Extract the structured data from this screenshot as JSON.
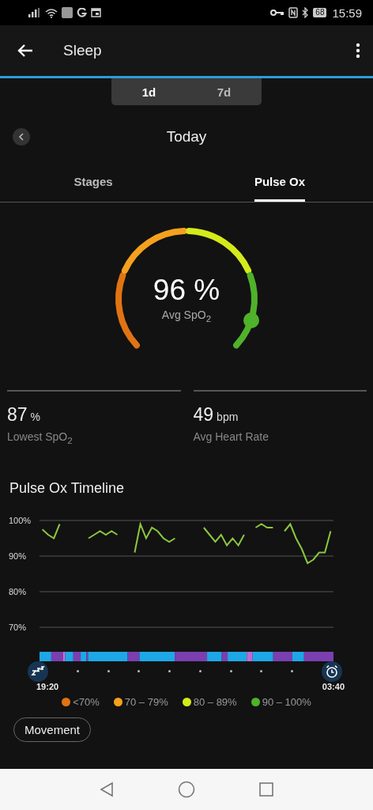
{
  "status_bar": {
    "battery": "68",
    "time": "15:59"
  },
  "app_bar": {
    "title": "Sleep"
  },
  "range_tabs": [
    {
      "label": "1d",
      "selected": true
    },
    {
      "label": "7d",
      "selected": false
    }
  ],
  "date": "Today",
  "tabs": [
    {
      "label": "Stages",
      "selected": false
    },
    {
      "label": "Pulse Ox",
      "selected": true
    }
  ],
  "gauge": {
    "value": "96 %",
    "label": "Avg SpO$_{2}$"
  },
  "stats": [
    {
      "value": "87",
      "unit": "%",
      "label": "Lowest SpO$_{2}$"
    },
    {
      "value": "49",
      "unit": "bpm",
      "label": "Avg Heart Rate"
    }
  ],
  "timeline": {
    "title": "Pulse Ox Timeline",
    "start_time": "19:20",
    "end_time": "03:40",
    "chart_data": {
      "type": "line",
      "categories": [
        null,
        null,
        null,
        null,
        null,
        null,
        null,
        null,
        null,
        null,
        null,
        null,
        null,
        null,
        null,
        null,
        null,
        null,
        null,
        null,
        null,
        null,
        null,
        null,
        null,
        null,
        null,
        null,
        null,
        null,
        null,
        null,
        null,
        null,
        null,
        null,
        null,
        null,
        null,
        null,
        null,
        null,
        null,
        null,
        null,
        null,
        null,
        null,
        null,
        null,
        null
      ],
      "series": [
        {
          "color": "#8cc63f",
          "values": [
            97.5,
            96,
            95,
            99,
            null,
            null,
            null,
            null,
            95,
            96,
            97,
            96,
            97,
            96,
            null,
            null,
            91,
            99,
            95,
            98,
            97,
            95,
            94,
            95,
            null,
            null,
            null,
            null,
            98,
            96,
            94,
            96,
            93,
            95,
            93,
            96,
            null,
            98,
            99,
            98,
            98,
            null,
            97,
            99,
            95,
            92,
            88,
            89,
            91,
            91,
            97
          ]
        }
      ],
      "grid": true,
      "ylim": [
        70,
        100
      ],
      "yticks": [
        {
          "value": 100,
          "label": "100%"
        },
        {
          "value": 90,
          "label": "90%"
        },
        {
          "value": 80,
          "label": "80%"
        },
        {
          "value": 70,
          "label": "70%"
        }
      ]
    }
  },
  "legend": [
    {
      "label": "<70%",
      "color": "#e07412"
    },
    {
      "label": "70 – 79%",
      "color": "#f5a01e"
    },
    {
      "label": "80 – 89%",
      "color": "#d4ea1a"
    },
    {
      "label": "90 – 100%",
      "color": "#4fb22a"
    }
  ],
  "movement_button": "Movement"
}
